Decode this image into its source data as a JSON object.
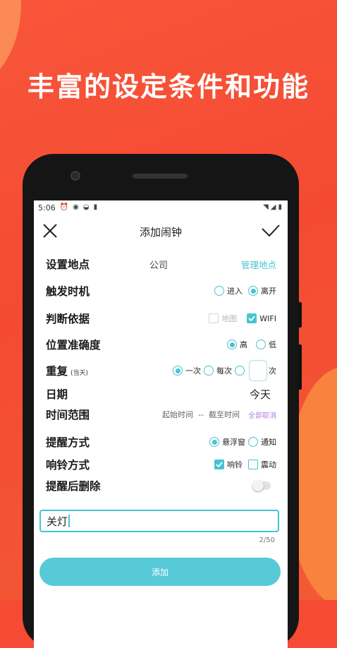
{
  "headline": "丰富的设定条件和功能",
  "status": {
    "time": "5:06"
  },
  "appbar": {
    "title": "添加闹钟"
  },
  "form": {
    "location": {
      "label": "设置地点",
      "value": "公司",
      "manage_link": "管理地点"
    },
    "trigger": {
      "label": "触发时机",
      "options": [
        "进入",
        "离开"
      ],
      "selected": "离开"
    },
    "basis": {
      "label": "判断依据",
      "options": [
        "地图",
        "WIFI"
      ],
      "checked": [
        "WIFI"
      ],
      "disabled": [
        "地图"
      ]
    },
    "accuracy": {
      "label": "位置准确度",
      "options": [
        "高",
        "低"
      ],
      "selected": "高"
    },
    "repeat": {
      "label": "重复",
      "sub_label": "(当天)",
      "options": [
        "一次",
        "每次"
      ],
      "selected": "一次",
      "custom_suffix": "次"
    },
    "date": {
      "label": "日期",
      "value": "今天"
    },
    "time_range": {
      "label": "时间范围",
      "start": "起始时间",
      "separator": "--",
      "end": "截至时间",
      "cancel_all": "全部取消"
    },
    "remind_mode": {
      "label": "提醒方式",
      "options": [
        "悬浮窗",
        "通知"
      ],
      "selected": "悬浮窗"
    },
    "ring_mode": {
      "label": "响铃方式",
      "options": [
        "响铃",
        "震动"
      ],
      "checked": [
        "响铃"
      ]
    },
    "delete_after": {
      "label": "提醒后删除",
      "enabled": false
    },
    "note": {
      "value": "关灯",
      "counter": "2/50"
    },
    "submit_label": "添加"
  },
  "colors": {
    "accent": "#45c4d3",
    "background": "#f44a33",
    "cancel_link": "#b57ee0"
  }
}
